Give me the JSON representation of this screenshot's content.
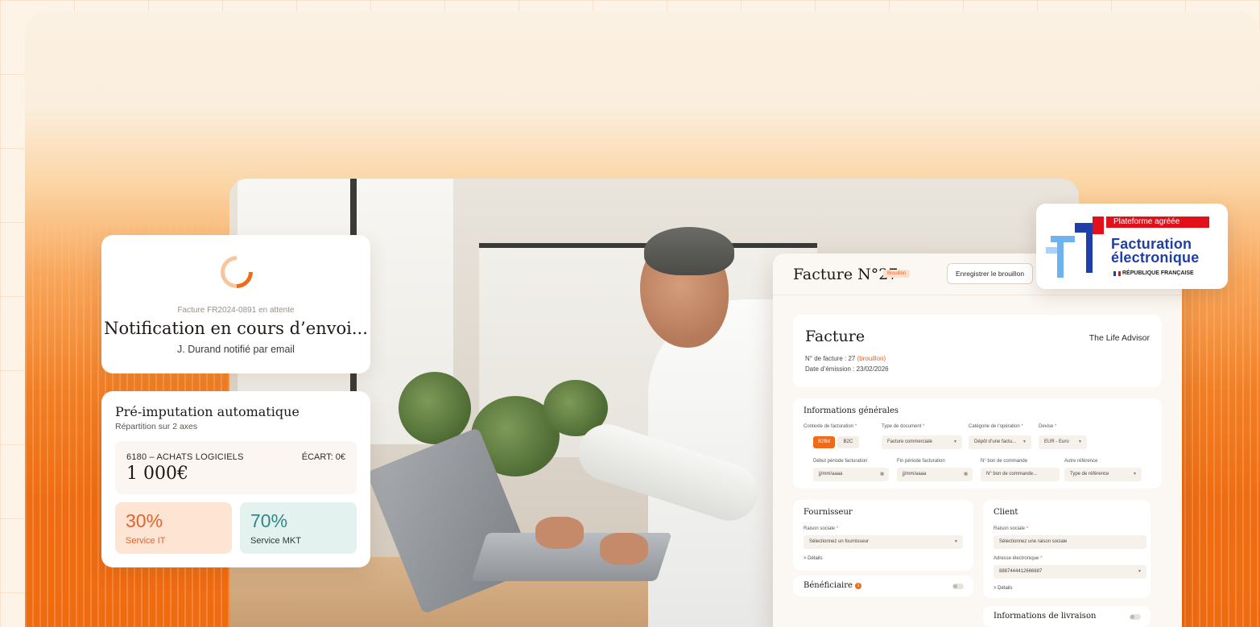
{
  "notification": {
    "subtitle": "Facture FR2024-0891 en attente",
    "title": "Notification en cours d’envoi...",
    "description": "J. Durand notifié par email"
  },
  "preimputation": {
    "title": "Pré-imputation automatique",
    "subtitle": "Répartition sur 2 axes",
    "account_code": "6180 – ACHATS LOGICIELS",
    "ecart": "ÉCART: 0€",
    "amount": "1 000€",
    "splits": [
      {
        "percent": "30%",
        "label": "Service IT"
      },
      {
        "percent": "70%",
        "label": "Service MKT"
      }
    ]
  },
  "invoice_app": {
    "title": "Facture N°27",
    "status_badge": "Brouillon",
    "save_button": "Enregistrer le brouillon",
    "card": {
      "heading": "Facture",
      "company": "The Life Advisor",
      "number_label": "N° de facture : 27 ",
      "number_status": "(brouillon)",
      "date": "Date d’émission : 23/02/2026"
    },
    "general": {
      "heading": "Informations générales",
      "labels": {
        "contexte": "Contexte de facturation",
        "type_doc": "Type de document",
        "categorie": "Catégorie de l’opération",
        "devise": "Devise",
        "debut": "Début période facturation",
        "fin": "Fin période facturation",
        "bon": "N° bon de commande",
        "autre": "Autre référence"
      },
      "contexte_options": [
        "B2Bd",
        "B2C"
      ],
      "type_doc_value": "Facture commerciale",
      "categorie_value": "Dépôt d’une factu...",
      "devise_value": "EUR - Euro",
      "debut_placeholder": "jj/mm/aaaa",
      "fin_placeholder": "jj/mm/aaaa",
      "bon_placeholder": "N° bon de commande...",
      "autre_value": "Type de référence"
    },
    "fournisseur": {
      "heading": "Fournisseur",
      "raison_label": "Raison sociale",
      "raison_placeholder": "Sélectionnez un fournisseur",
      "details": "> Détails"
    },
    "client": {
      "heading": "Client",
      "raison_label": "Raison sociale",
      "raison_placeholder": "Sélectionnez une raison sociale",
      "adresse_label": "Adresse électronique",
      "adresse_value": "8887444412666687",
      "details": "> Détails"
    },
    "beneficiaire": "Bénéficiaire",
    "livraison": "Informations de livraison"
  },
  "certification": {
    "tag": "Plateforme agréée",
    "line1": "Facturation",
    "line2": "électronique",
    "line3": "RÉPUBLIQUE FRANÇAISE"
  },
  "colors": {
    "accent": "#ef6b1a",
    "brand_blue": "#1f3fa8",
    "brand_red": "#e1101a",
    "teal": "#2f8a84"
  }
}
